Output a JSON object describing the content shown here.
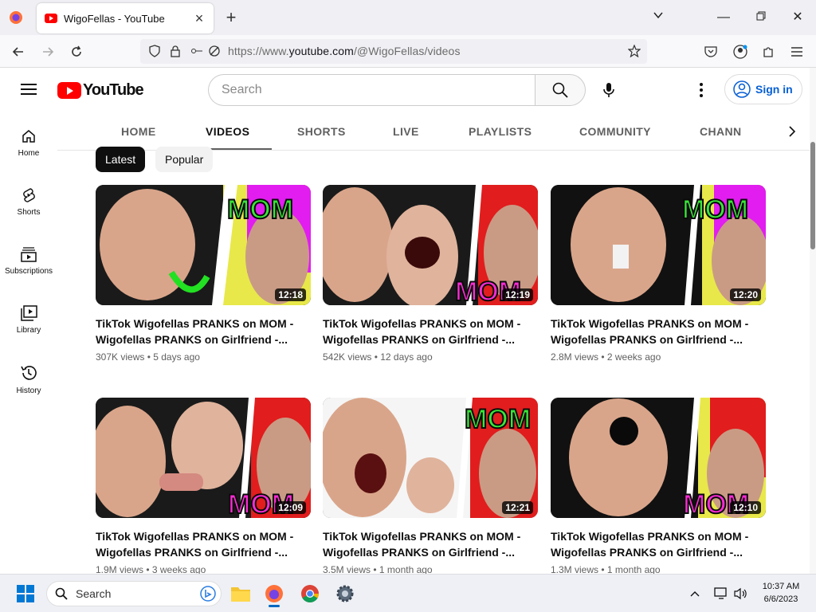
{
  "browser": {
    "tab_title": "WigoFellas - YouTube",
    "url_prefix": "https://www.",
    "url_domain": "youtube.com",
    "url_path": "/@WigoFellas/videos"
  },
  "header": {
    "logo_text": "YouTube",
    "search_placeholder": "Search",
    "signin_label": "Sign in"
  },
  "sidebar": {
    "items": [
      {
        "label": "Home"
      },
      {
        "label": "Shorts"
      },
      {
        "label": "Subscriptions"
      },
      {
        "label": "Library"
      },
      {
        "label": "History"
      }
    ]
  },
  "channel_tabs": [
    "HOME",
    "VIDEOS",
    "SHORTS",
    "LIVE",
    "PLAYLISTS",
    "COMMUNITY",
    "CHANN"
  ],
  "chips": [
    "Latest",
    "Popular"
  ],
  "videos": [
    {
      "title": "TikTok Wigofellas PRANKS on MOM - Wigofellas PRANKS on Girlfriend -...",
      "meta": "307K views • 5 days ago",
      "duration": "12:18"
    },
    {
      "title": "TikTok Wigofellas PRANKS on MOM - Wigofellas PRANKS on Girlfriend -...",
      "meta": "542K views • 12 days ago",
      "duration": "12:19"
    },
    {
      "title": "TikTok Wigofellas PRANKS on MOM - Wigofellas PRANKS on Girlfriend -...",
      "meta": "2.8M views • 2 weeks ago",
      "duration": "12:20"
    },
    {
      "title": "TikTok Wigofellas PRANKS on MOM - Wigofellas PRANKS on Girlfriend -...",
      "meta": "1.9M views • 3 weeks ago",
      "duration": "12:09"
    },
    {
      "title": "TikTok Wigofellas PRANKS on MOM - Wigofellas PRANKS on Girlfriend -...",
      "meta": "3.5M views • 1 month ago",
      "duration": "12:21"
    },
    {
      "title": "TikTok Wigofellas PRANKS on MOM - Wigofellas PRANKS on Girlfriend -...",
      "meta": "1.3M views • 1 month ago",
      "duration": "12:10"
    }
  ],
  "thumb_text": [
    "MOM",
    "MOM",
    "MOM",
    "MOM",
    "MOM",
    "MOM"
  ],
  "taskbar": {
    "search_label": "Search",
    "time": "10:37 AM",
    "date": "6/6/2023"
  },
  "colors": {
    "yt_red": "#ff0000",
    "link_blue": "#065fd4",
    "mom_green": "#39e639",
    "mom_pink": "#ff2bd6"
  }
}
